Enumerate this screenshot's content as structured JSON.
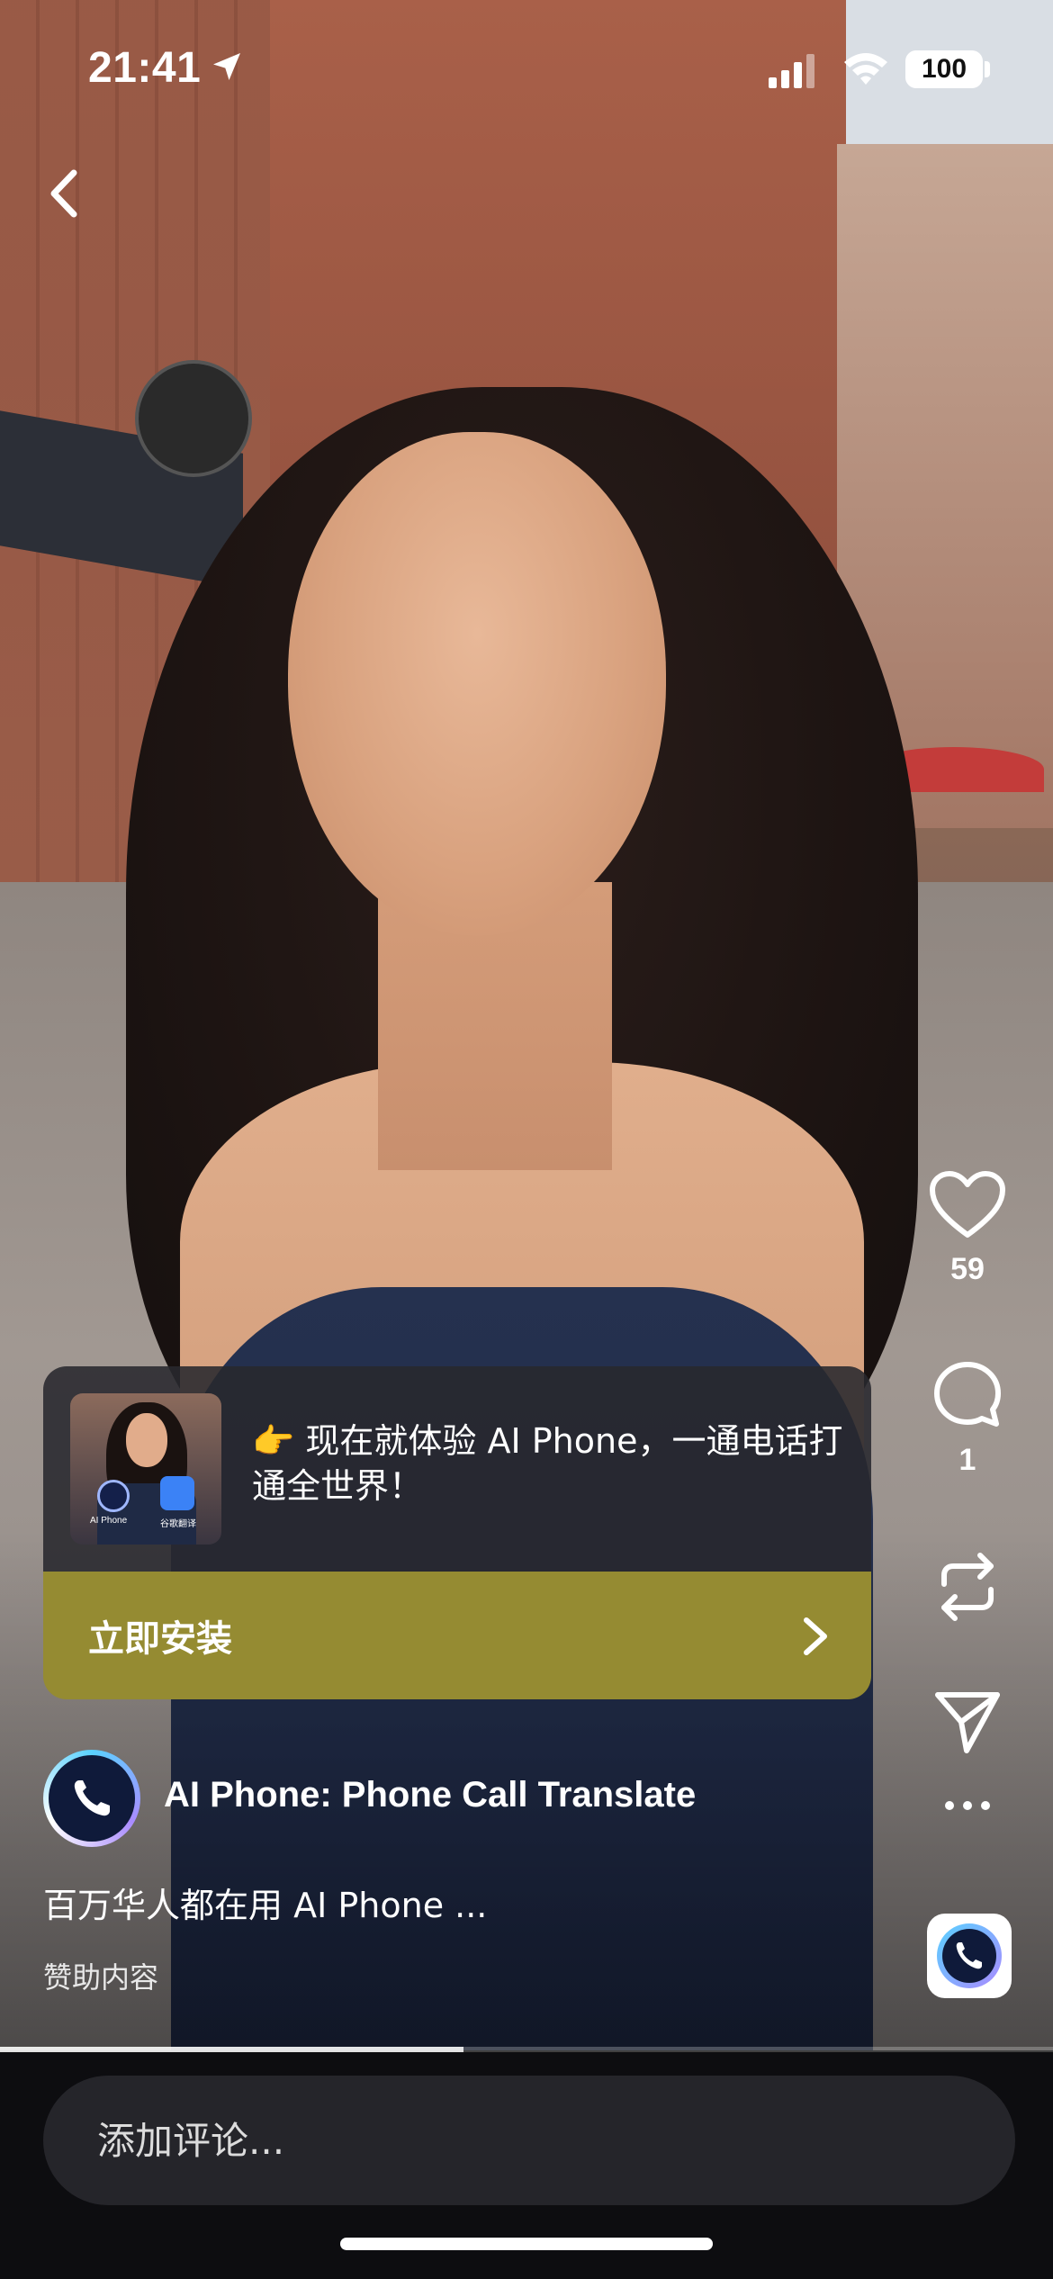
{
  "status_bar": {
    "time": "21:41",
    "battery": "100"
  },
  "rail": {
    "like_count": "59",
    "comment_count": "1"
  },
  "ad": {
    "text": "👉 现在就体验 AI Phone，一通电话打通全世界！",
    "cta_label": "立即安装",
    "thumb_label_left": "AI Phone",
    "thumb_label_right": "谷歌翻译"
  },
  "sponsor": {
    "name": "AI Phone: Phone Call Translate",
    "description": "百万华人都在用 AI Phone ...",
    "tag": "赞助内容"
  },
  "progress": 0.44,
  "comment_box": {
    "placeholder": "添加评论..."
  },
  "colors": {
    "cta_background": "#958b32",
    "bottom_bar": "#0d0d10",
    "comment_field": "#25252a"
  }
}
